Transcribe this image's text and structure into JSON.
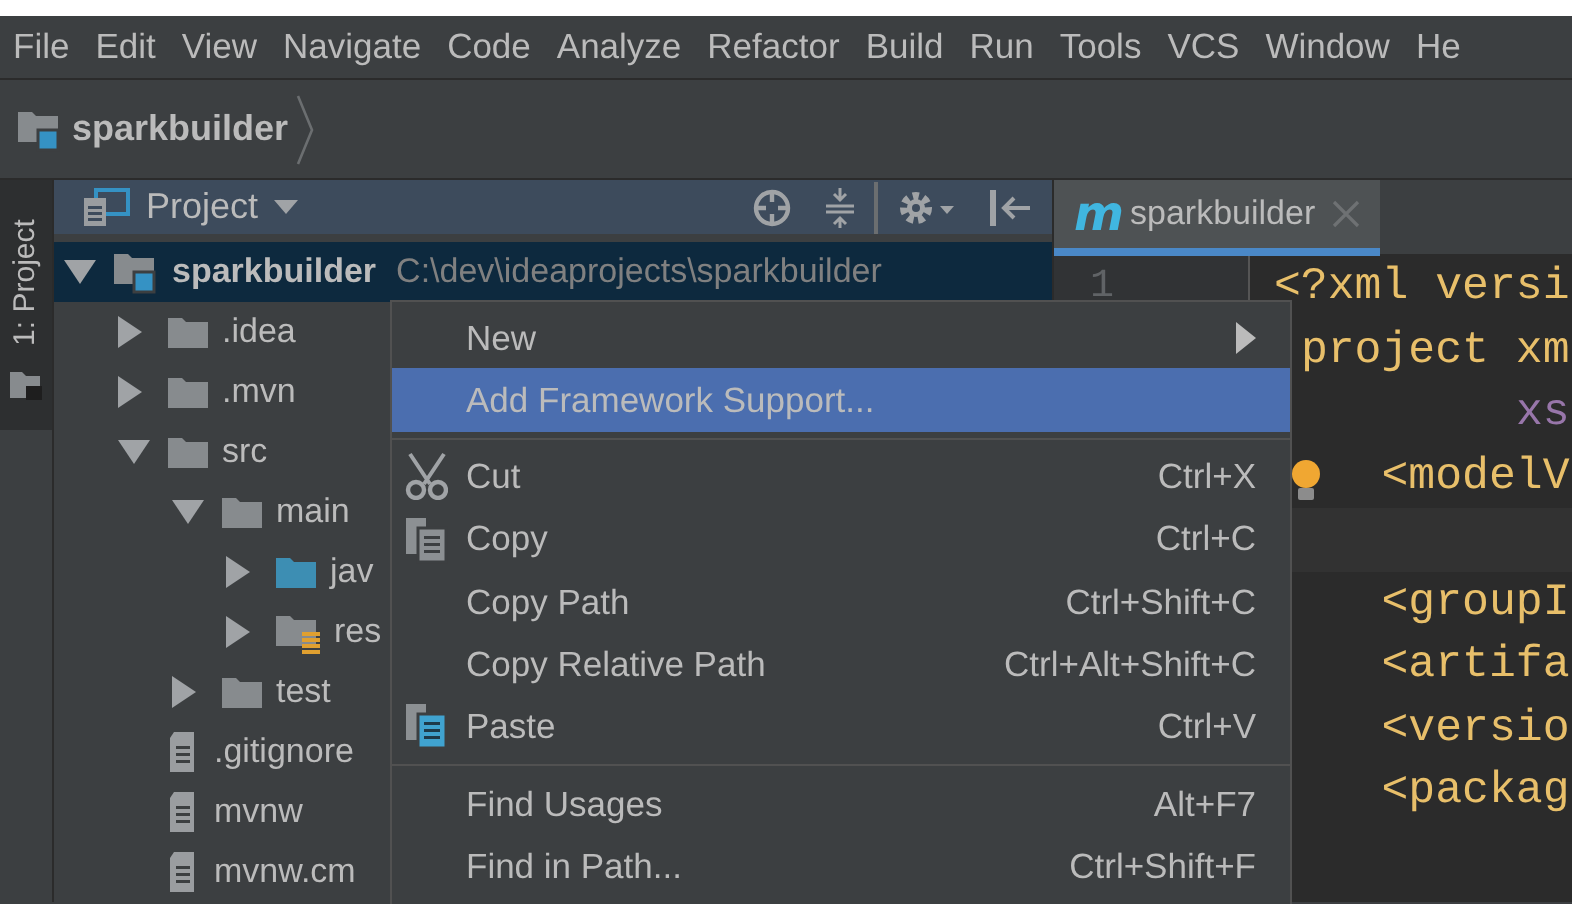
{
  "menubar": [
    "File",
    "Edit",
    "View",
    "Navigate",
    "Code",
    "Analyze",
    "Refactor",
    "Build",
    "Run",
    "Tools",
    "VCS",
    "Window",
    "He"
  ],
  "breadcrumb": {
    "label": "sparkbuilder"
  },
  "tool_stripe": {
    "tabs": [
      {
        "label": "1: Project",
        "selected": true
      }
    ]
  },
  "project_panel": {
    "title": "Project",
    "tree": [
      {
        "label": "sparkbuilder",
        "path": "C:\\dev\\ideaprojects\\sparkbuilder",
        "kind": "module",
        "expanded": true,
        "selected": true,
        "children": [
          {
            "label": ".idea",
            "kind": "folder",
            "expanded": false,
            "selected": false
          },
          {
            "label": ".mvn",
            "kind": "folder",
            "expanded": false,
            "selected": false
          },
          {
            "label": "src",
            "kind": "folder",
            "expanded": true,
            "selected": false,
            "children": [
              {
                "label": "main",
                "kind": "folder",
                "expanded": true,
                "selected": false,
                "children": [
                  {
                    "label": "jav",
                    "kind": "source",
                    "expanded": false,
                    "selected": false
                  },
                  {
                    "label": "res",
                    "kind": "resources",
                    "expanded": false,
                    "selected": false
                  }
                ]
              },
              {
                "label": "test",
                "kind": "folder",
                "expanded": false,
                "selected": false
              }
            ]
          },
          {
            "label": ".gitignore",
            "kind": "file",
            "selected": false
          },
          {
            "label": "mvnw",
            "kind": "file",
            "selected": false
          },
          {
            "label": "mvnw.cm",
            "kind": "file",
            "selected": false
          }
        ]
      }
    ]
  },
  "editor": {
    "tabs": [
      {
        "icon_text": "m",
        "label": "sparkbuilder",
        "selected": true
      }
    ],
    "line_numbers": [
      "1"
    ],
    "lines": [
      {
        "kind": "tag",
        "text": "<?xml versi"
      },
      {
        "kind": "tag",
        "text": " project xm"
      },
      {
        "kind": "attribute",
        "text": "         xs"
      },
      {
        "kind": "tag",
        "text": "    <modelV",
        "lightbulb": true
      },
      {
        "kind": "blank",
        "current": true
      },
      {
        "kind": "tag",
        "text": "    <groupI"
      },
      {
        "kind": "tag",
        "text": "    <artifa"
      },
      {
        "kind": "tag",
        "text": "    <versio"
      },
      {
        "kind": "tag",
        "text": "    <packag"
      }
    ]
  },
  "context_menu": {
    "items": [
      {
        "kind": "submenu",
        "label": "New",
        "selected": false
      },
      {
        "kind": "plain",
        "label": "Add Framework Support...",
        "selected": true
      },
      {
        "kind": "separator"
      },
      {
        "kind": "scissors",
        "label": "Cut",
        "shortcut": "Ctrl+X",
        "selected": false
      },
      {
        "kind": "copy",
        "label": "Copy",
        "shortcut": "Ctrl+C",
        "selected": false
      },
      {
        "kind": "plain",
        "label": "Copy Path",
        "shortcut": "Ctrl+Shift+C",
        "selected": false
      },
      {
        "kind": "plain",
        "label": "Copy Relative Path",
        "shortcut": "Ctrl+Alt+Shift+C",
        "selected": false
      },
      {
        "kind": "paste",
        "label": "Paste",
        "shortcut": "Ctrl+V",
        "selected": false
      },
      {
        "kind": "separator"
      },
      {
        "kind": "plain",
        "label": "Find Usages",
        "shortcut": "Alt+F7",
        "selected": false
      },
      {
        "kind": "plain",
        "label": "Find in Path...",
        "shortcut": "Ctrl+Shift+F",
        "selected": false
      }
    ]
  }
}
